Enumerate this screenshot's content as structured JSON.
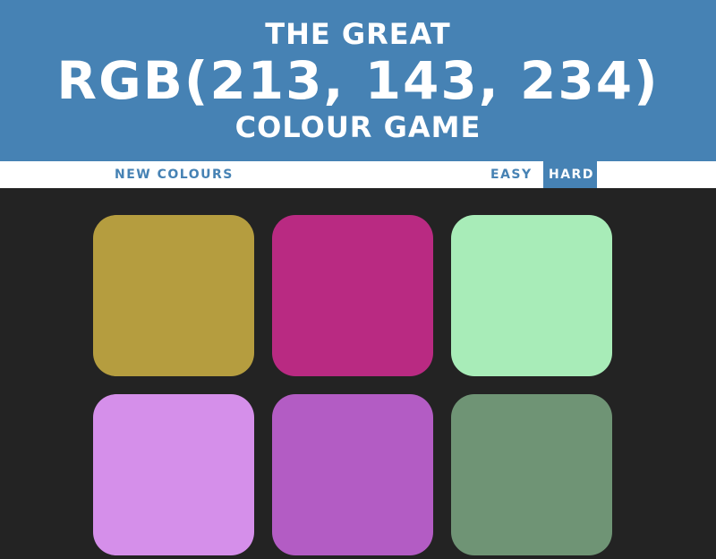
{
  "header": {
    "line1": "THE GREAT",
    "target_rgb": "RGB(213, 143, 234)",
    "line3": "COLOUR GAME",
    "background": "#4682b4"
  },
  "controls": {
    "new_colours_label": "NEW COLOURS",
    "message": "",
    "easy_label": "EASY",
    "hard_label": "HARD",
    "selected_mode": "HARD"
  },
  "board": {
    "background": "#232323",
    "squares": [
      {
        "color": "#b59d3f"
      },
      {
        "color": "#b92a82"
      },
      {
        "color": "#a8ecb8"
      },
      {
        "color": "#d58fea"
      },
      {
        "color": "#b35cc4"
      },
      {
        "color": "#6f9475"
      }
    ]
  }
}
